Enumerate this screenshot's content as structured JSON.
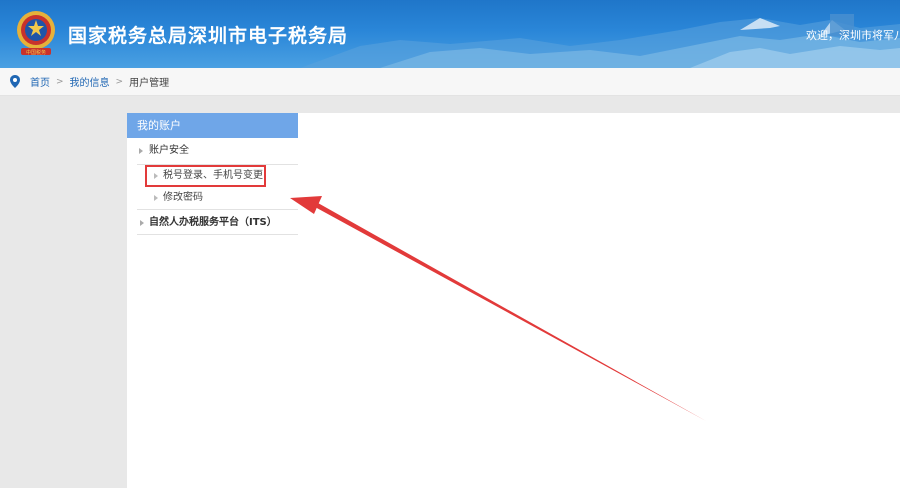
{
  "header": {
    "site_title": "国家税务总局深圳市电子税务局",
    "welcome_text": "欢迎，深圳市将军八"
  },
  "breadcrumb": {
    "items": [
      "首页",
      "我的信息"
    ],
    "current": "用户管理",
    "separator": ">"
  },
  "sidebar": {
    "title": "我的账户",
    "groups": [
      {
        "label": "账户安全",
        "items": [
          {
            "label": "税号登录、手机号变更",
            "highlighted": true
          },
          {
            "label": "修改密码"
          }
        ]
      },
      {
        "label": "自然人办税服务平台（ITS）"
      }
    ]
  },
  "colors": {
    "header_blue": "#2a86d8",
    "sidebar_title_bg": "#6fa6e8",
    "annotation_red": "#e23a3a",
    "link_blue": "#1f66b3"
  },
  "annotation": {
    "type": "red-arrow-and-box",
    "target": "税号登录、手机号变更"
  }
}
